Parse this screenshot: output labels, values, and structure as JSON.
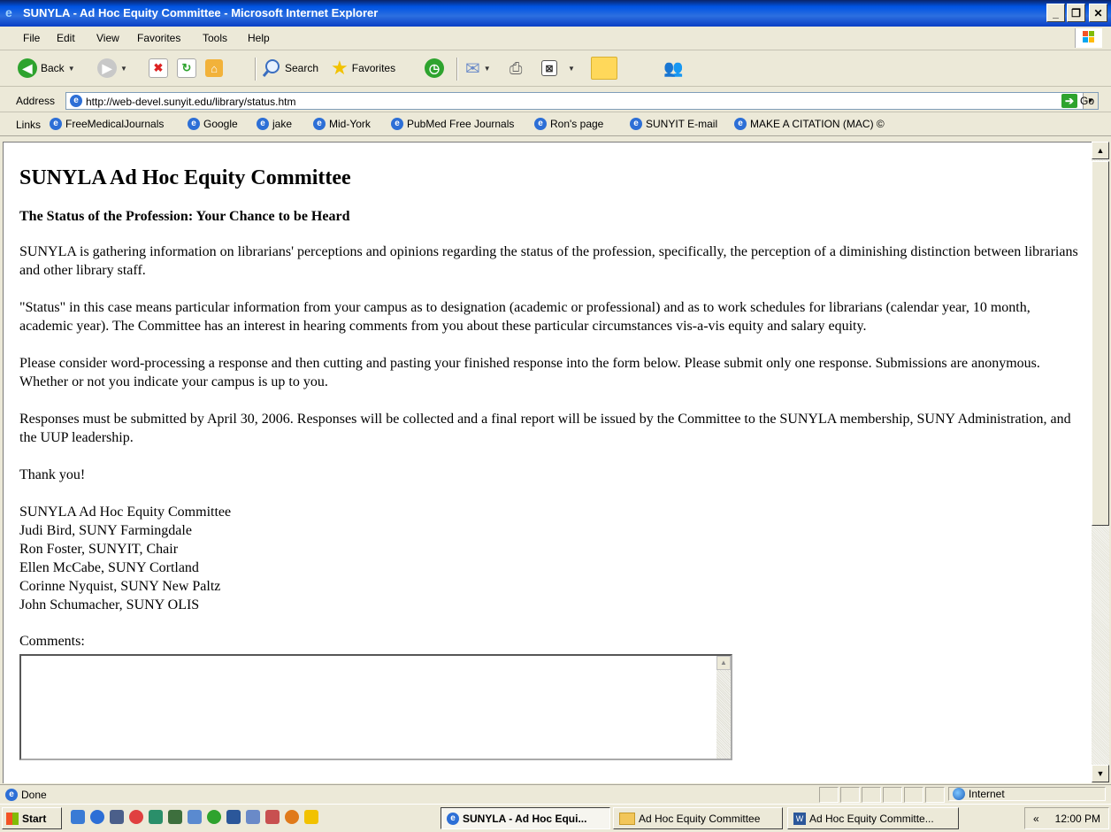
{
  "window": {
    "title": "SUNYLA - Ad Hoc Equity Committee - Microsoft Internet Explorer",
    "minimize": "_",
    "maximize": "❐",
    "close": "✕"
  },
  "menu": [
    "File",
    "Edit",
    "View",
    "Favorites",
    "Tools",
    "Help"
  ],
  "toolbar": {
    "back": "Back",
    "search": "Search",
    "favorites": "Favorites"
  },
  "address": {
    "label": "Address",
    "url": "http://web-devel.sunyit.edu/library/status.htm",
    "go": "Go"
  },
  "links": {
    "label": "Links",
    "items": [
      "FreeMedicalJournals",
      "Google",
      "jake",
      "Mid-York",
      "PubMed Free Journals",
      "Ron's page",
      "SUNYIT E-mail",
      "MAKE A CITATION (MAC) ©"
    ]
  },
  "page": {
    "heading": "SUNYLA Ad Hoc Equity Committee",
    "subheading": "The Status of the Profession: Your Chance to be Heard",
    "paragraphs": [
      "SUNYLA is gathering information on librarians' perceptions and opinions regarding the status of the profession, specifically, the perception of a diminishing distinction between librarians and other library staff.",
      "\"Status\" in this case means particular information from your campus as to designation (academic or professional) and as to work schedules for librarians (calendar year, 10 month, academic year). The Committee has an interest in hearing comments from you about these particular circumstances vis-a-vis equity and salary equity.",
      "Please consider word-processing a response and then cutting and pasting your finished response into the form below. Please submit only one response. Submissions are anonymous. Whether or not you indicate your campus is up to you.",
      "Responses must be submitted by April 30, 2006. Responses will be collected and a final report will be issued by the Committee to the SUNYLA membership, SUNY Administration, and the UUP leadership.",
      "Thank you!"
    ],
    "signature": [
      "SUNYLA Ad Hoc Equity Committee",
      "Judi Bird, SUNY Farmingdale",
      "Ron Foster, SUNYIT, Chair",
      "Ellen McCabe, SUNY Cortland",
      "Corinne Nyquist, SUNY New Paltz",
      "John Schumacher, SUNY OLIS"
    ],
    "comments_label": "Comments:",
    "comments_value": ""
  },
  "status": {
    "text": "Done",
    "zone": "Internet"
  },
  "taskbar": {
    "start": "start",
    "tasks": [
      "SUNYLA - Ad Hoc Equi...",
      "Ad Hoc Equity Committee",
      "Ad Hoc Equity Committe..."
    ],
    "chevron": "«",
    "clock": "12:00 PM"
  }
}
